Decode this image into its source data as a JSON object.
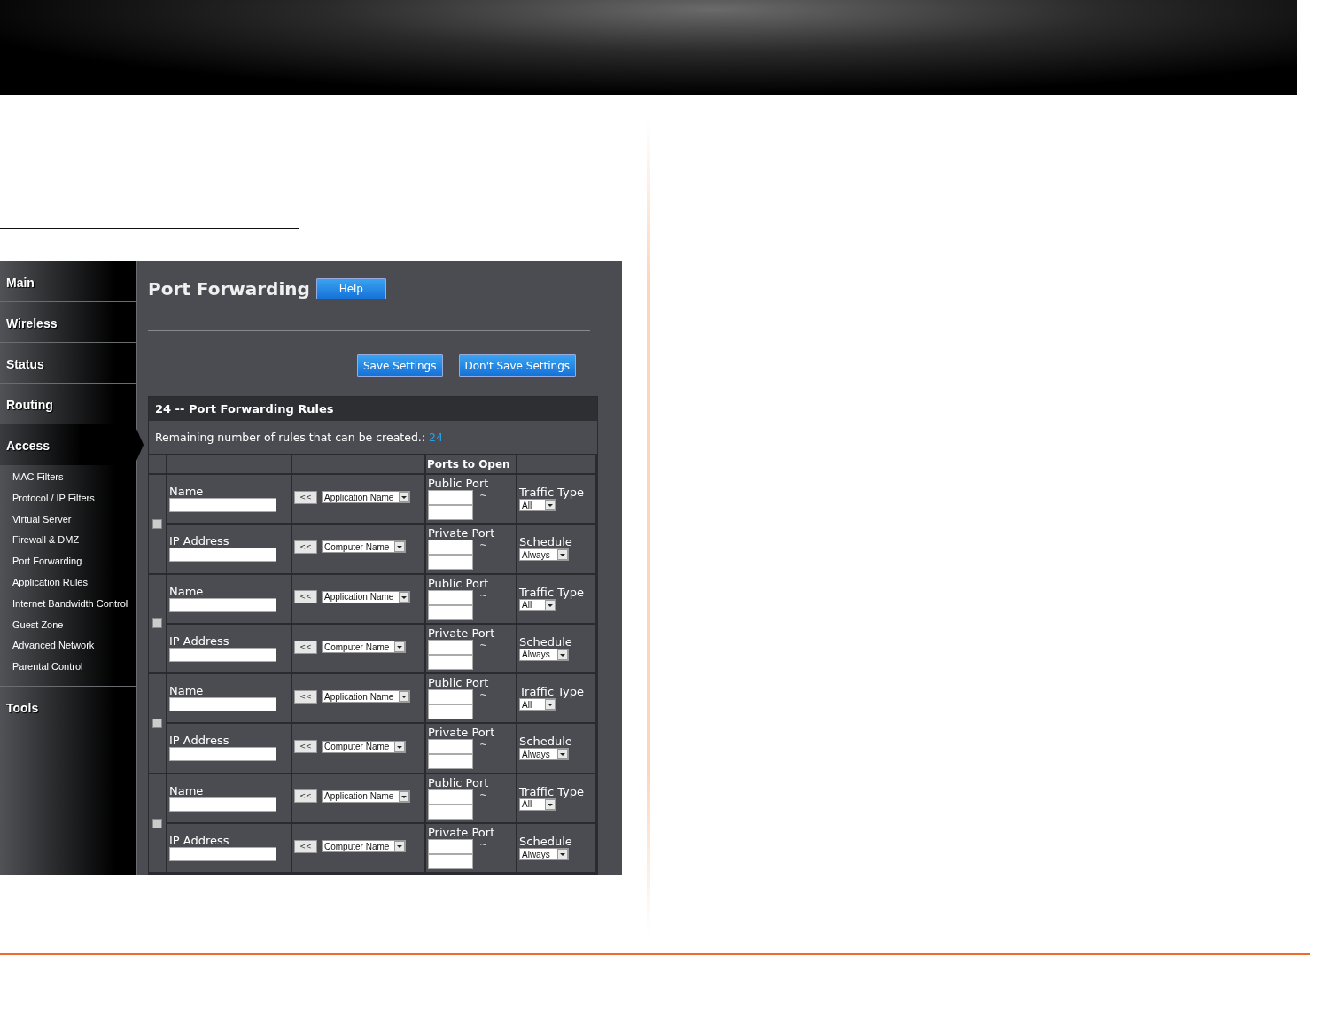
{
  "nav": [
    {
      "label": "Main",
      "selected": false
    },
    {
      "label": "Wireless",
      "selected": false
    },
    {
      "label": "Status",
      "selected": false
    },
    {
      "label": "Routing",
      "selected": false
    },
    {
      "label": "Access",
      "selected": true,
      "children": [
        "MAC Filters",
        "Protocol / IP Filters",
        "Virtual Server",
        "Firewall & DMZ",
        "Port Forwarding",
        "Application Rules",
        "Internet Bandwidth Control",
        "Guest Zone",
        "Advanced Network",
        "Parental Control"
      ]
    },
    {
      "label": "Tools",
      "selected": false
    }
  ],
  "title": "Port Forwarding",
  "help_button": "Help",
  "buttons": [
    "Save Settings",
    "Don't Save Settings"
  ],
  "rules_header": "24 -- Port Forwarding Rules",
  "remaining_label": "Remaining number of rules that can be created.:",
  "remaining_value": "24",
  "ports_header": "Ports to Open",
  "rules": [
    {
      "checked": false,
      "name_label": "Name",
      "app_button": "<<",
      "app_select": "Application Name",
      "public_label": "Public Port",
      "public_tilde": "~",
      "traffic_label": "Traffic Type",
      "traffic_select": "All",
      "ip_label": "IP Address",
      "computer_button": "<<",
      "computer_select": "Computer Name",
      "private_label": "Private Port",
      "private_tilde": "~",
      "schedule_label": "Schedule",
      "schedule_select": "Always"
    },
    {
      "checked": false,
      "name_label": "Name",
      "app_button": "<<",
      "app_select": "Application Name",
      "public_label": "Public Port",
      "public_tilde": "~",
      "traffic_label": "Traffic Type",
      "traffic_select": "All",
      "ip_label": "IP Address",
      "computer_button": "<<",
      "computer_select": "Computer Name",
      "private_label": "Private Port",
      "private_tilde": "~",
      "schedule_label": "Schedule",
      "schedule_select": "Always"
    },
    {
      "checked": false,
      "name_label": "Name",
      "app_button": "<<",
      "app_select": "Application Name",
      "public_label": "Public Port",
      "public_tilde": "~",
      "traffic_label": "Traffic Type",
      "traffic_select": "All",
      "ip_label": "IP Address",
      "computer_button": "<<",
      "computer_select": "Computer Name",
      "private_label": "Private Port",
      "private_tilde": "~",
      "schedule_label": "Schedule",
      "schedule_select": "Always"
    },
    {
      "checked": false,
      "name_label": "Name",
      "app_button": "<<",
      "app_select": "Application Name",
      "public_label": "Public Port",
      "public_tilde": "~",
      "traffic_label": "Traffic Type",
      "traffic_select": "All",
      "ip_label": "IP Address",
      "computer_button": "<<",
      "computer_select": "Computer Name",
      "private_label": "Private Port",
      "private_tilde": "~",
      "schedule_label": "Schedule",
      "schedule_select": "Always"
    }
  ]
}
